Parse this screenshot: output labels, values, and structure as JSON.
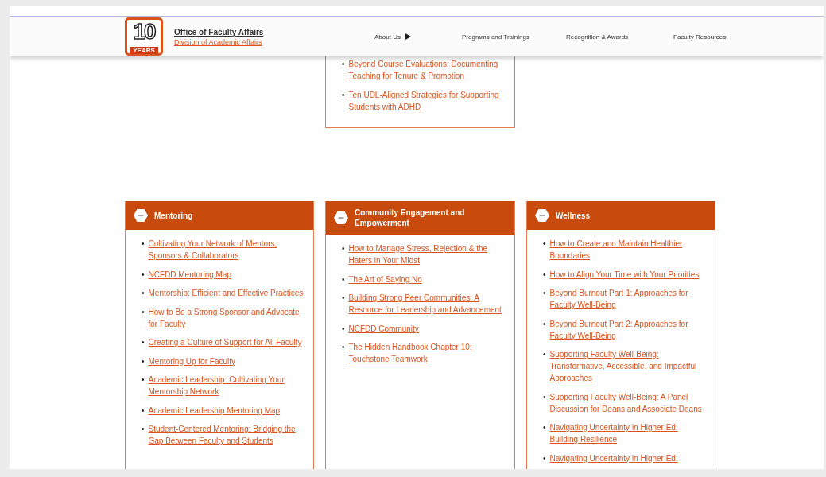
{
  "header": {
    "logo": {
      "number": "10",
      "badge": "YEARS"
    },
    "title": "Office of Faculty Affairs",
    "subtitle": "Division of Academic Affairs",
    "nav": [
      {
        "label": "About Us",
        "has_arrow": true
      },
      {
        "label": "Programs and Trainings",
        "has_arrow": false
      },
      {
        "label": "Recognition & Awards",
        "has_arrow": false
      },
      {
        "label": "Faculty Resources",
        "has_arrow": false
      }
    ]
  },
  "top_card": {
    "links": [
      {
        "bullet": "•",
        "text": "Beyond Course Evaluations: Documenting Teaching for Tenure & Promotion"
      },
      {
        "bullet": "•",
        "text": "Ten UDL-Aligned Strategies for Supporting Students with ADHD"
      }
    ]
  },
  "cards": [
    {
      "title": "Mentoring",
      "expanded": true,
      "links": [
        {
          "bullet": "•",
          "text": "Cultivating Your Network of Mentors, Sponsors & Collaborators"
        },
        {
          "bullet": "•",
          "text": "NCFDD Mentoring Map"
        },
        {
          "bullet": "•",
          "text": "Mentorship: Efficient and Effective Practices"
        },
        {
          "bullet": "•",
          "text": "How to Be a Strong Sponsor and Advocate for Faculty"
        },
        {
          "bullet": "•",
          "text": "Creating a Culture of Support for All Faculty"
        },
        {
          "bullet": "•",
          "text": "Mentoring Up for Faculty"
        },
        {
          "bullet": "•",
          "text": "Academic Leadership: Cultivating Your Mentorship Network"
        },
        {
          "bullet": "•",
          "text": "Academic Leadership Mentoring Map"
        },
        {
          "bullet": "•",
          "text": "Student-Centered Mentoring: Bridging the Gap Between Faculty and Students"
        }
      ]
    },
    {
      "title": "Community Engagement and Empowerment",
      "expanded": true,
      "links": [
        {
          "bullet": "•",
          "text": "How to Manage Stress, Rejection & the Haters in Your Midst"
        },
        {
          "bullet": "•",
          "text": "The Art of Saying No"
        },
        {
          "bullet": "•",
          "text": "Building Strong Peer Communities: A Resource for Leadership and Advancement"
        },
        {
          "bullet": "•",
          "text": "NCFDD Community"
        },
        {
          "bullet": "•",
          "text": "The Hidden Handbook Chapter 10: Touchstone Teamwork"
        }
      ]
    },
    {
      "title": "Wellness",
      "expanded": true,
      "links": [
        {
          "bullet": "•",
          "text": "How to Create and Maintain Healthier Boundaries"
        },
        {
          "bullet": "•",
          "text": "How to Align Your Time with Your Priorities"
        },
        {
          "bullet": "•",
          "text": "Beyond Burnout Part 1: Approaches for Faculty Well-Being"
        },
        {
          "bullet": "•",
          "text": "Beyond Burnout Part 2: Approaches for Faculty Well-Being"
        },
        {
          "bullet": "•",
          "text": "Supporting Faculty Well-Being: Transformative, Accessible, and Impactful Approaches"
        },
        {
          "bullet": "•",
          "text": "Supporting Faculty Well-Being: A Panel Discussion for Deans and Associate Deans"
        },
        {
          "bullet": "•",
          "text": "Navigating Uncertainty in Higher Ed: Building Resilience"
        },
        {
          "bullet": "•",
          "text": "Navigating Uncertainty in Higher Ed:"
        }
      ]
    }
  ]
}
